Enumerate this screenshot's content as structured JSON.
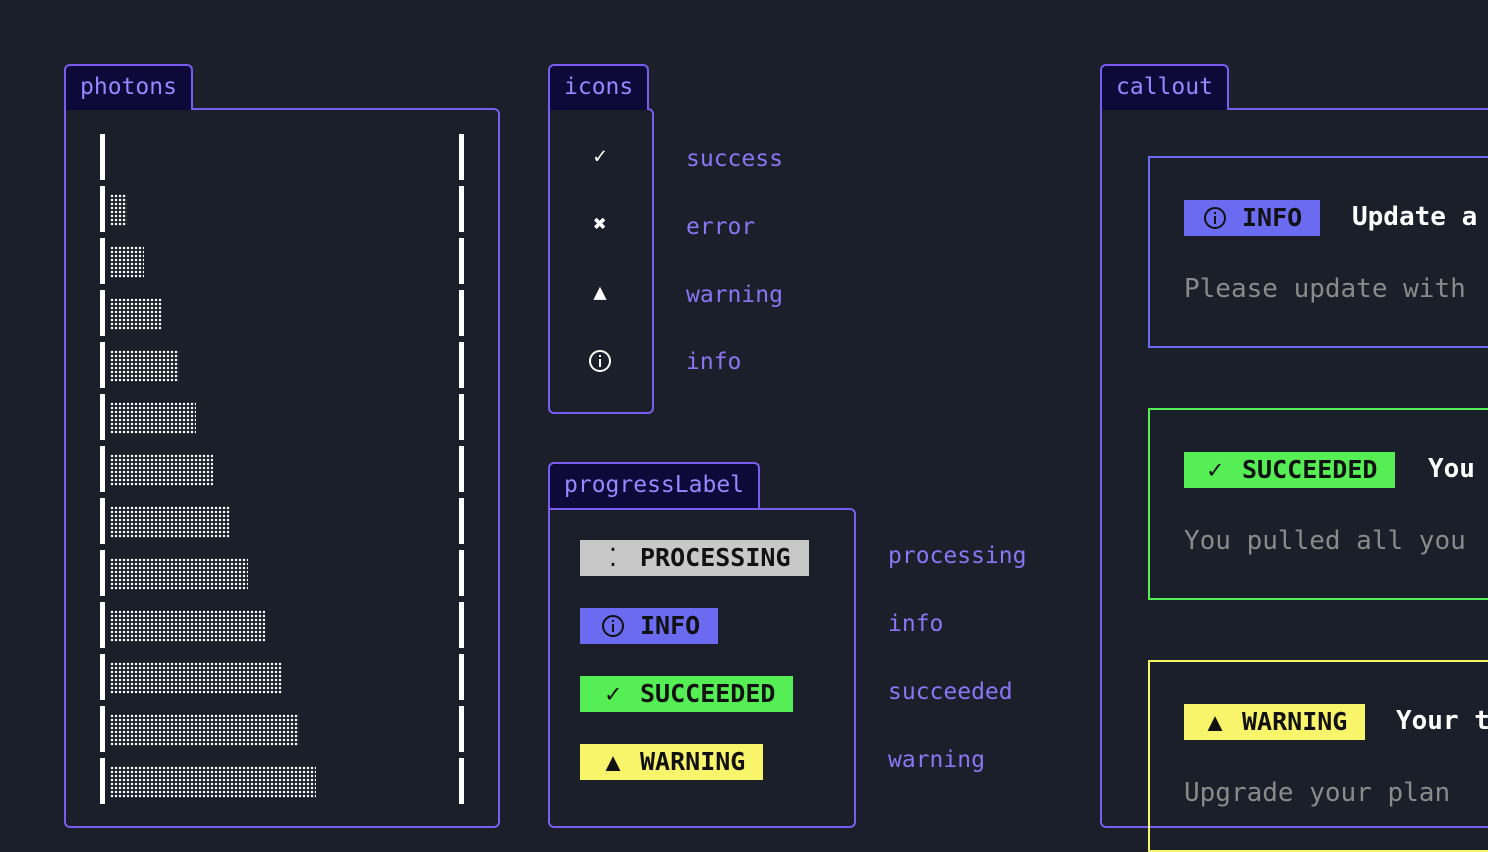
{
  "panels": {
    "photons": {
      "tab": "photons"
    },
    "icons": {
      "tab": "icons"
    },
    "progress": {
      "tab": "progressLabel"
    },
    "callout": {
      "tab": "callout"
    }
  },
  "photons": {
    "levels": [
      0,
      1,
      2,
      3,
      4,
      5,
      6,
      7,
      8,
      9,
      10,
      11,
      12
    ],
    "max_level": 20
  },
  "icons": [
    {
      "glyph": "check-icon",
      "label": "success"
    },
    {
      "glyph": "cross-icon",
      "label": "error"
    },
    {
      "glyph": "triangle-icon",
      "label": "warning"
    },
    {
      "glyph": "info-circle-icon",
      "label": "info"
    }
  ],
  "progress_labels": [
    {
      "icon": "spinner-icon",
      "text": "PROCESSING",
      "label": "processing",
      "color": "#c8c8c8"
    },
    {
      "icon": "info-circle-icon",
      "text": "INFO",
      "label": "info",
      "color": "#6b6bf2"
    },
    {
      "icon": "check-icon",
      "text": "SUCCEEDED",
      "label": "succeeded",
      "color": "#55ee55"
    },
    {
      "icon": "triangle-icon",
      "text": "WARNING",
      "label": "warning",
      "color": "#f9f56a"
    }
  ],
  "callouts": [
    {
      "icon": "info-circle-icon",
      "badge": "INFO",
      "title": "Update a",
      "body": "Please update with",
      "color": "#6b6bf2"
    },
    {
      "icon": "check-icon",
      "badge": "SUCCEEDED",
      "title": "You",
      "body": "You pulled all you",
      "color": "#55ee55"
    },
    {
      "icon": "triangle-icon",
      "badge": "WARNING",
      "title": "Your t",
      "body": "Upgrade your plan",
      "color": "#f9f56a"
    }
  ]
}
